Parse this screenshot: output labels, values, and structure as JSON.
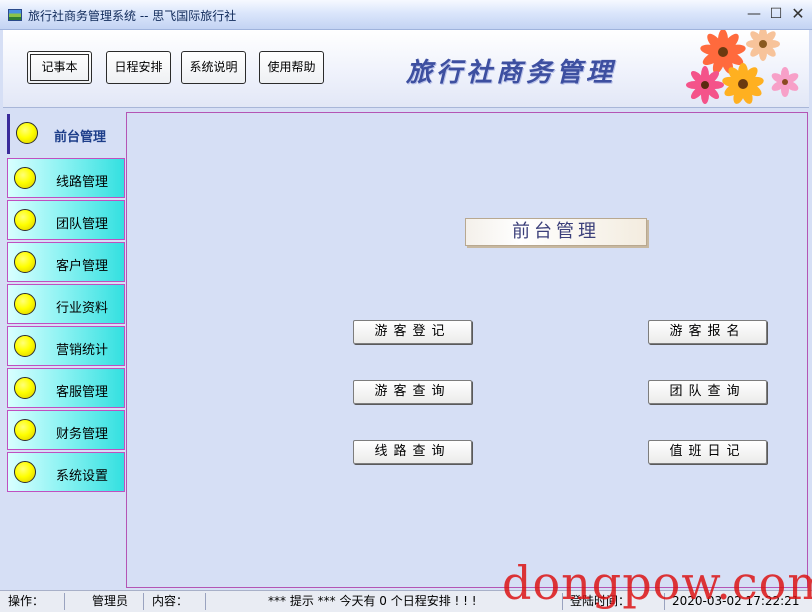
{
  "window": {
    "title": "旅行社商务管理系统 -- 思飞国际旅行社",
    "min_glyph": "—",
    "max_glyph": "☐",
    "close_glyph": "✕"
  },
  "toolbar": {
    "buttons": [
      {
        "label": "记事本"
      },
      {
        "label": "日程安排"
      },
      {
        "label": "系统说明"
      },
      {
        "label": "使用帮助"
      }
    ],
    "brand_title": "旅行社商务管理"
  },
  "sidebar": {
    "items": [
      {
        "label": "前台管理",
        "active": true
      },
      {
        "label": "线路管理"
      },
      {
        "label": "团队管理"
      },
      {
        "label": "客户管理"
      },
      {
        "label": "行业资料"
      },
      {
        "label": "营销统计"
      },
      {
        "label": "客服管理"
      },
      {
        "label": "财务管理"
      },
      {
        "label": "系统设置"
      }
    ]
  },
  "main": {
    "panel_title": "前台管理",
    "buttons": [
      {
        "label": "游客登记"
      },
      {
        "label": "游客报名"
      },
      {
        "label": "游客查询"
      },
      {
        "label": "团队查询"
      },
      {
        "label": "线路查询"
      },
      {
        "label": "值班日记"
      }
    ]
  },
  "statusbar": {
    "operator_label": "操作：",
    "operator_value": "管理员",
    "content_label": "内容：",
    "hint": "*** 提示 ***    今天有 0 个日程安排 ! ! !",
    "login_label": "登陆时间：",
    "login_time": "2020-03-02 17:22:21"
  },
  "watermark": "dongpow.com",
  "colors": {
    "sidebar_gradient_end": "#33e0e0",
    "panel_border": "#b455b4",
    "brand_title": "#3d4fa0",
    "indicator_dot": "#ffff00"
  }
}
